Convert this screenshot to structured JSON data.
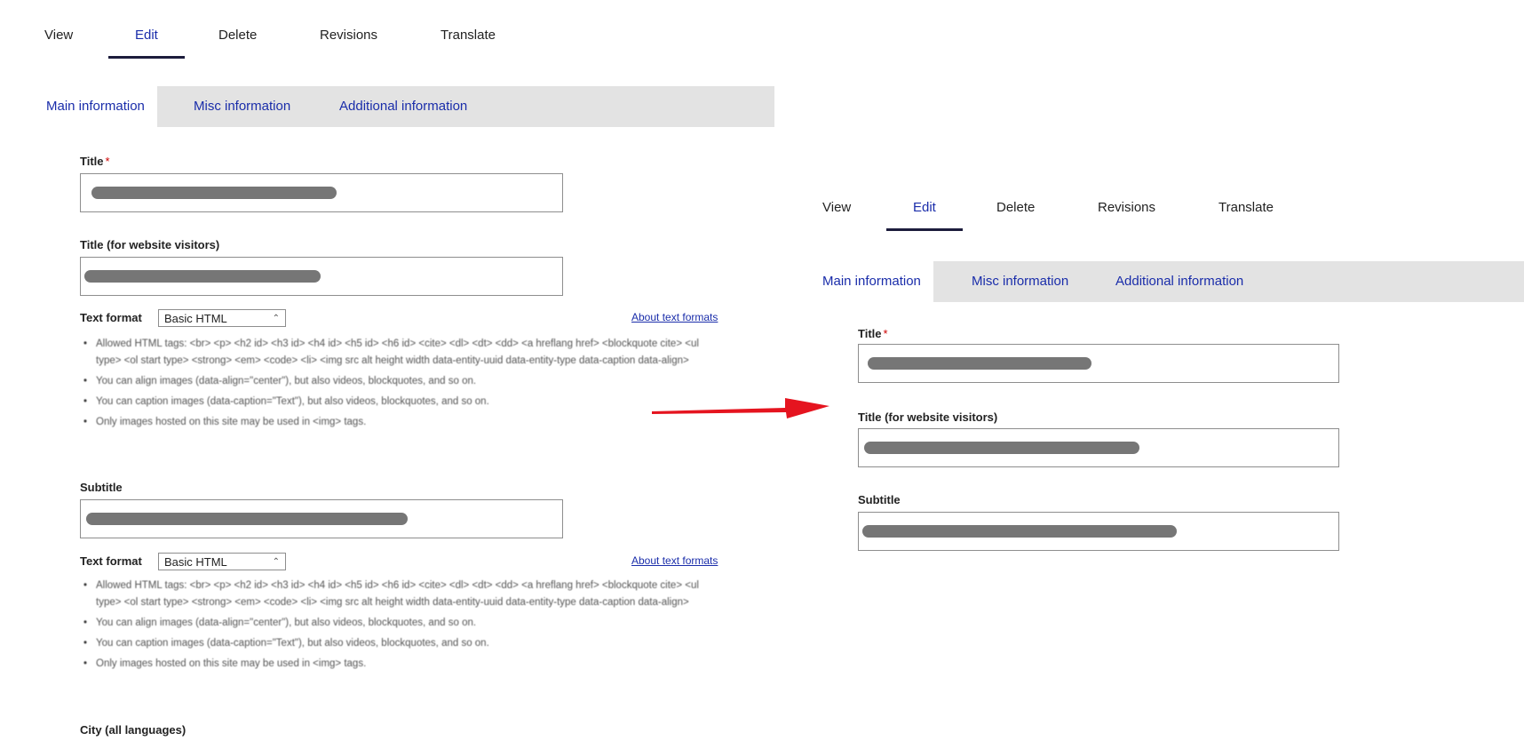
{
  "left_panel": {
    "primary_tabs": [
      {
        "label": "View"
      },
      {
        "label": "Edit"
      },
      {
        "label": "Delete"
      },
      {
        "label": "Revisions"
      },
      {
        "label": "Translate"
      }
    ],
    "secondary_tabs": [
      {
        "label": "Main information"
      },
      {
        "label": "Misc information"
      },
      {
        "label": "Additional information"
      }
    ],
    "fields": {
      "title_label": "Title",
      "title_required_mark": "*",
      "visitor_title_label": "Title (for website visitors)",
      "subtitle_label": "Subtitle",
      "city_label": "City (all languages)"
    },
    "text_format_1": {
      "label": "Text format",
      "value": "Basic HTML",
      "link": "About text formats",
      "tips": [
        "Allowed HTML tags: <br> <p> <h2 id> <h3 id> <h4 id> <h5 id> <h6 id> <cite> <dl> <dt> <dd> <a hreflang href> <blockquote cite> <ul type> <ol start type> <strong> <em> <code> <li> <img src alt height width data-entity-uuid data-entity-type data-caption data-align>",
        "You can align images (data-align=\"center\"), but also videos, blockquotes, and so on.",
        "You can caption images (data-caption=\"Text\"), but also videos, blockquotes, and so on.",
        "Only images hosted on this site may be used in <img> tags."
      ]
    },
    "text_format_2": {
      "label": "Text format",
      "value": "Basic HTML",
      "link": "About text formats",
      "tips": [
        "Allowed HTML tags: <br> <p> <h2 id> <h3 id> <h4 id> <h5 id> <h6 id> <cite> <dl> <dt> <dd> <a hreflang href> <blockquote cite> <ul type> <ol start type> <strong> <em> <code> <li> <img src alt height width data-entity-uuid data-entity-type data-caption data-align>",
        "You can align images (data-align=\"center\"), but also videos, blockquotes, and so on.",
        "You can caption images (data-caption=\"Text\"), but also videos, blockquotes, and so on.",
        "Only images hosted on this site may be used in <img> tags."
      ]
    }
  },
  "right_panel": {
    "primary_tabs": [
      {
        "label": "View"
      },
      {
        "label": "Edit"
      },
      {
        "label": "Delete"
      },
      {
        "label": "Revisions"
      },
      {
        "label": "Translate"
      }
    ],
    "secondary_tabs": [
      {
        "label": "Main information"
      },
      {
        "label": "Misc information"
      },
      {
        "label": "Additional information"
      }
    ],
    "fields": {
      "title_label": "Title",
      "title_required_mark": "*",
      "visitor_title_label": "Title (for website visitors)",
      "subtitle_label": "Subtitle"
    }
  },
  "colors": {
    "link": "#1a2daa",
    "tab_bar": "#e3e3e3",
    "arrow": "#e5141f",
    "redaction": "#767676"
  }
}
